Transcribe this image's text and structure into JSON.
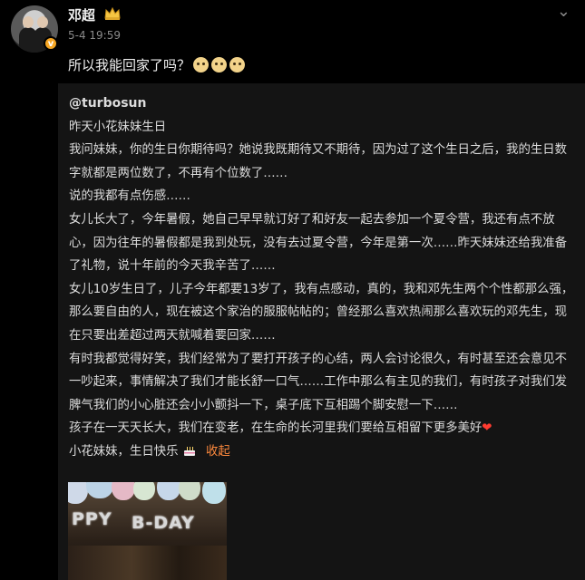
{
  "author": {
    "name": "邓超",
    "badge_icon": "crown-icon",
    "timestamp": "5-4 19:59"
  },
  "post": {
    "text": "所以我能回家了吗？",
    "emojis": [
      "cat-face-emoji",
      "cat-face-emoji",
      "cat-face-emoji"
    ]
  },
  "repost": {
    "user": "@turbosun",
    "lines": [
      "昨天小花妹妹生日",
      "我问妹妹，你的生日你期待吗？她说我既期待又不期待，因为过了这个生日之后，我的生日数字就都是两位数了，不再有个位数了……",
      "说的我都有点伤感……",
      "女儿长大了，今年暑假，她自己早早就订好了和好友一起去参加一个夏令营，我还有点不放心，因为往年的暑假都是我到处玩，没有去过夏令营，今年是第一次……昨天妹妹还给我准备了礼物，说十年前的今天我辛苦了……",
      "女儿10岁生日了，儿子今年都要13岁了，我有点感动，真的，我和邓先生两个个性都那么强，那么要自由的人，现在被这个家治的服服帖帖的；曾经那么喜欢热闹那么喜欢玩的邓先生，现在只要出差超过两天就喊着要回家……",
      "有时我都觉得好笑，我们经常为了要打开孩子的心结，两人会讨论很久，有时甚至还会意见不一吵起来，事情解决了我们才能长舒一口气……工作中那么有主见的我们，有时孩子对我们发脾气我们的小心脏还会小小颤抖一下，桌子底下互相踢个脚安慰一下……",
      "孩子在一天天长大，我们在变老，在生命的长河里我们要给互相留下更多美好"
    ],
    "last_line": "小花妹妹，生日快乐",
    "collapse_label": "收起",
    "photo_banner_left": "PPY",
    "photo_banner_right": "B-DAY"
  },
  "colors": {
    "background": "#000000",
    "card": "#141414",
    "link": "#ff8a3d",
    "heart": "#ff3b30"
  }
}
